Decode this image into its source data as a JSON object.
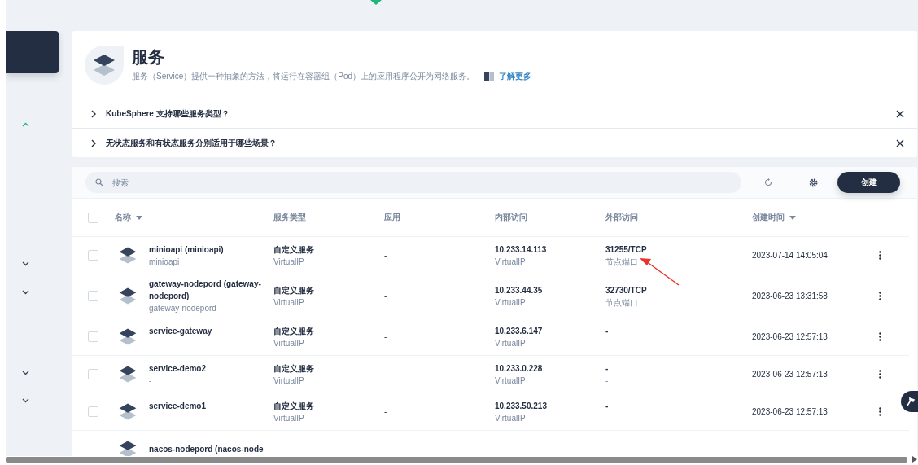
{
  "sidebar": {
    "chevrons": [
      {
        "expanded": true
      },
      {
        "expanded": false
      },
      {
        "expanded": false
      },
      {
        "expanded": false
      },
      {
        "expanded": false
      }
    ]
  },
  "header": {
    "title": "服务",
    "description": "服务（Service）提供一种抽象的方法，将运行在容器组（Pod）上的应用程序公开为网络服务。",
    "link": "了解更多"
  },
  "faq": [
    {
      "question": "KubeSphere 支持哪些服务类型？"
    },
    {
      "question": "无状态服务和有状态服务分别适用于哪些场景？"
    }
  ],
  "toolbar": {
    "search": {
      "placeholder": "搜索"
    },
    "create_button": "创建"
  },
  "table": {
    "select_all": false,
    "columns": [
      {
        "label": "名称",
        "sortable": true
      },
      {
        "label": "服务类型",
        "sortable": false
      },
      {
        "label": "应用",
        "sortable": false
      },
      {
        "label": "内部访问",
        "sortable": false
      },
      {
        "label": "外部访问",
        "sortable": false
      },
      {
        "label": "创建时间",
        "sortable": true
      }
    ],
    "rows": [
      {
        "selected": false,
        "name": "minioapi (minioapi)",
        "alias": "minioapi",
        "type": "自定义服务",
        "type_sub": "VirtualIP",
        "app": "-",
        "internal": "10.233.14.113",
        "internal_sub": "VirtualIP",
        "external": "31255/TCP",
        "external_sub": "节点端口",
        "created": "2023-07-14 14:05:04"
      },
      {
        "selected": false,
        "name": "gateway-nodepord (gateway-nodepord)",
        "alias": "gateway-nodepord",
        "type": "自定义服务",
        "type_sub": "VirtualIP",
        "app": "-",
        "internal": "10.233.44.35",
        "internal_sub": "VirtualIP",
        "external": "32730/TCP",
        "external_sub": "节点端口",
        "created": "2023-06-23 13:31:58"
      },
      {
        "selected": false,
        "name": "service-gateway",
        "alias": "-",
        "type": "自定义服务",
        "type_sub": "VirtualIP",
        "app": "-",
        "internal": "10.233.6.147",
        "internal_sub": "VirtualIP",
        "external": "-",
        "external_sub": "-",
        "created": "2023-06-23 12:57:13"
      },
      {
        "selected": false,
        "name": "service-demo2",
        "alias": "-",
        "type": "自定义服务",
        "type_sub": "VirtualIP",
        "app": "-",
        "internal": "10.233.0.228",
        "internal_sub": "VirtualIP",
        "external": "-",
        "external_sub": "-",
        "created": "2023-06-23 12:57:13"
      },
      {
        "selected": false,
        "name": "service-demo1",
        "alias": "-",
        "type": "自定义服务",
        "type_sub": "VirtualIP",
        "app": "-",
        "internal": "10.233.50.213",
        "internal_sub": "VirtualIP",
        "external": "-",
        "external_sub": "-",
        "created": "2023-06-23 12:57:13"
      },
      {
        "name": "nacos-nodepord (nacos-node"
      }
    ]
  }
}
